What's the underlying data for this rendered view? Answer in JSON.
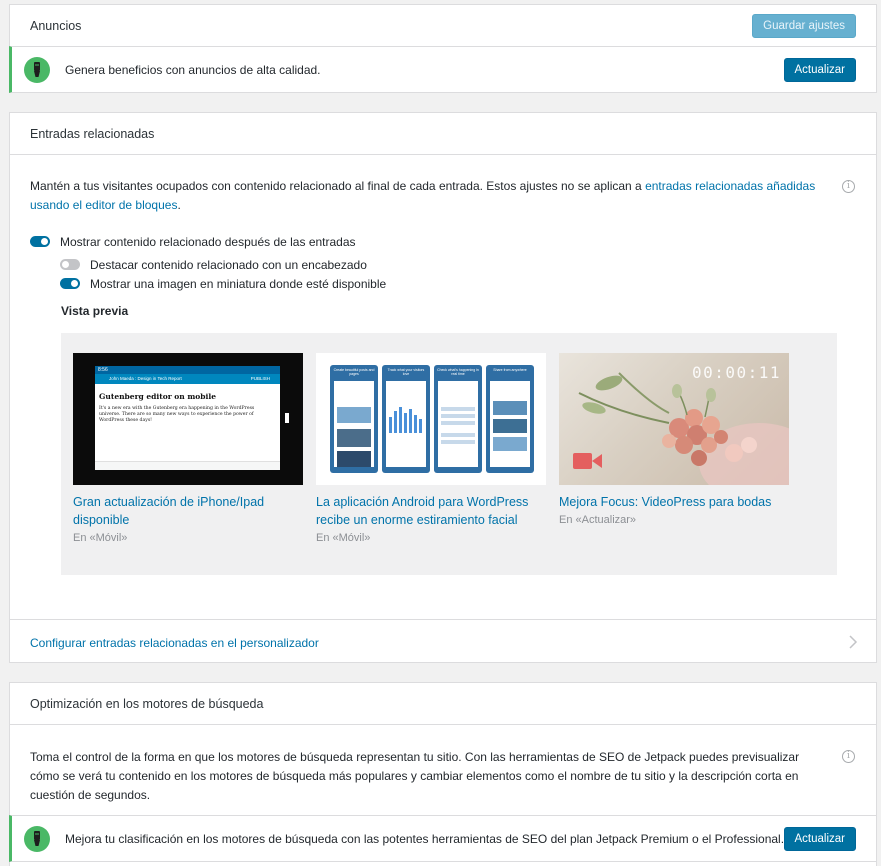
{
  "ads": {
    "title": "Anuncios",
    "save_button": "Guardar ajustes",
    "nudge_text": "Genera beneficios con anuncios de alta calidad.",
    "upgrade_button": "Actualizar"
  },
  "related": {
    "title": "Entradas relacionadas",
    "description": "Mantén a tus visitantes ocupados con contenido relacionado al final de cada entrada. Estos ajustes no se aplican a ",
    "description_link": "entradas relacionadas añadidas usando el editor de bloques",
    "description_end": ".",
    "toggles": [
      {
        "label": "Mostrar contenido relacionado después de las entradas",
        "on": true
      },
      {
        "label": "Destacar contenido relacionado con un encabezado",
        "on": false
      },
      {
        "label": "Mostrar una imagen en miniatura donde esté disponible",
        "on": true
      }
    ],
    "preview_label": "Vista previa",
    "posts": [
      {
        "title": "Gran actualización de iPhone/Ipad disponible",
        "context": "En «Móvil»",
        "thumb": {
          "status_time": "8:56",
          "toolbar_title": "John Maeda : Design in Tech Report",
          "toolbar_action": "PUBLISH",
          "heading": "Gutenberg editor on mobile",
          "body": "It's a new era with the Gutenberg era happening in the WordPress universe. There are so many new ways to experience the power of WordPress these days!"
        }
      },
      {
        "title": "La aplicación Android para WordPress recibe un enorme estiramiento facial",
        "context": "En «Móvil»",
        "thumb": {
          "captions": [
            "Create beautiful posts and pages",
            "Track what your visitors love",
            "Check what's happening in real time",
            "Share from anywhere"
          ]
        }
      },
      {
        "title": "Mejora Focus: VideoPress para bodas",
        "context": "En «Actualizar»",
        "thumb": {
          "timecode": "00:00:11"
        }
      }
    ],
    "footer_link": "Configurar entradas relacionadas en el personalizador"
  },
  "seo": {
    "title": "Optimización en los motores de búsqueda",
    "description": "Toma el control de la forma en que los motores de búsqueda representan tu sitio. Con las herramientas de SEO de Jetpack puedes previsualizar cómo se verá tu contenido en los motores de búsqueda más populares y cambiar elementos como el nombre de tu sitio y la descripción corta en cuestión de segundos.",
    "nudge_text": "Mejora tu clasificación en los motores de búsqueda con las potentes herramientas de SEO del plan Jetpack Premium o el Professional.",
    "upgrade_button": "Actualizar"
  },
  "icons": {
    "plan": "jetpack-plan-icon",
    "info": "info-icon",
    "chevron": "chevron-right-icon",
    "video": "video-camera-icon"
  },
  "colors": {
    "accent": "#0071a1",
    "link": "#0073aa",
    "nudge_border": "#4ab866",
    "preview_bg": "#f0f0f1"
  }
}
